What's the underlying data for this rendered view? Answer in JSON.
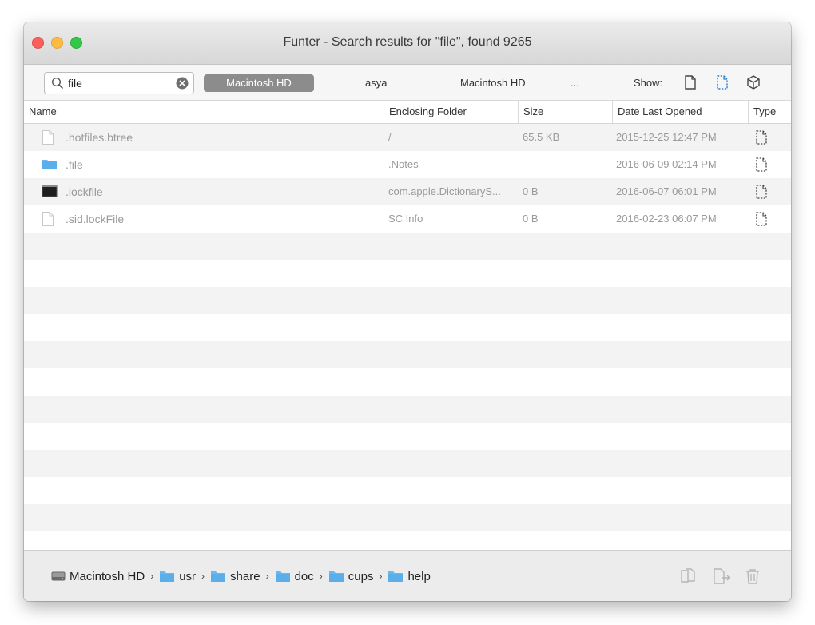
{
  "window": {
    "title": "Funter - Search results for \"file\", found 9265"
  },
  "toolbar": {
    "search_value": "file",
    "scopes": [
      "Macintosh HD",
      "asya",
      "Macintosh HD",
      "..."
    ],
    "active_scope": "Macintosh HD",
    "show_label": "Show:"
  },
  "columns": [
    "Name",
    "Enclosing Folder",
    "Size",
    "Date Last Opened",
    "Type"
  ],
  "rows": [
    {
      "name": ".hotfiles.btree",
      "folder": "/",
      "size": "65.5 KB",
      "date": "2015-12-25 12:47 PM",
      "icon": "document-icon"
    },
    {
      "name": ".file",
      "folder": ".Notes",
      "size": "--",
      "date": "2016-06-09 02:14 PM",
      "icon": "folder-icon"
    },
    {
      "name": ".lockfile",
      "folder": "com.apple.DictionaryS...",
      "size": "0 B",
      "date": "2016-06-07 06:01 PM",
      "icon": "terminal-icon"
    },
    {
      "name": ".sid.lockFile",
      "folder": "SC Info",
      "size": "0 B",
      "date": "2016-02-23 06:07 PM",
      "icon": "document-icon"
    }
  ],
  "footer": {
    "breadcrumb": [
      "Macintosh HD",
      "usr",
      "share",
      "doc",
      "cups",
      "help"
    ],
    "actions": [
      "copy-icon",
      "move-icon",
      "trash-icon"
    ]
  },
  "colors": {
    "accent": "#2a7fd8",
    "folder": "#6cb8ee",
    "active_scope_bg": "#8c8c8c"
  }
}
